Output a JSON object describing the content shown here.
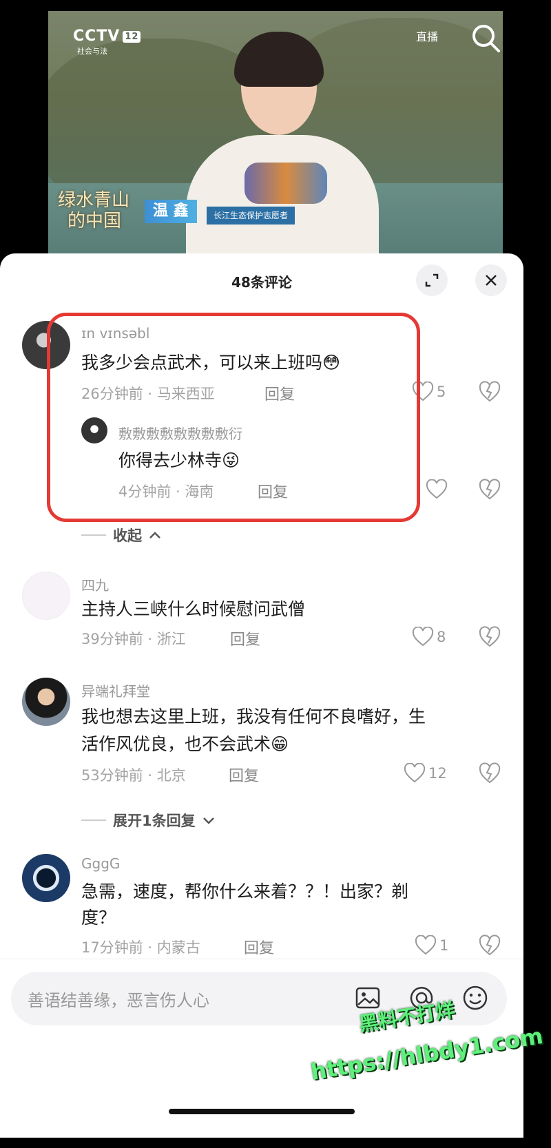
{
  "video": {
    "channel_logo": "CCTV",
    "channel_number": "12",
    "channel_sub": "社会与法",
    "live_label": "直播",
    "show_logo_line1": "绿水青山",
    "show_logo_line2": "的中国",
    "name_tag": "温 鑫",
    "role_tag": "长江生态保护志愿者"
  },
  "sheet": {
    "title": "48条评论"
  },
  "comments": [
    {
      "user": "ɪn vɪnsəbl",
      "text": "我多少会点武术，可以来上班吗😳",
      "meta": "26分钟前 · 马来西亚",
      "reply_label": "回复",
      "likes": "5"
    },
    {
      "user": "敷敷敷敷敷敷敷敷衍",
      "text": "你得去少林寺😜",
      "meta": "4分钟前 · 海南",
      "reply_label": "回复",
      "likes": ""
    },
    {
      "user": "四九",
      "text": "主持人三峡什么时候慰问武僧",
      "meta": "39分钟前 · 浙江",
      "reply_label": "回复",
      "likes": "8"
    },
    {
      "user": "异端礼拜堂",
      "text_line1": "我也想去这里上班，我没有任何不良嗜好，生",
      "text_line2": "活作风优良，也不会武术😁",
      "meta": "53分钟前 · 北京",
      "reply_label": "回复",
      "likes": "12"
    },
    {
      "user": "GggG",
      "text_line1": "急需，速度，帮你什么来着？？！出家？剃",
      "text_line2": "度？",
      "meta": "17分钟前 · 内蒙古",
      "reply_label": "回复",
      "likes": "1"
    }
  ],
  "toggles": {
    "collapse": "收起",
    "expand": "展开1条回复"
  },
  "input": {
    "placeholder": "善语结善缘，恶言伤人心"
  },
  "watermark": {
    "line1": "黑料不打烊",
    "line2": "https://hlbdy1.com"
  },
  "icons": [
    "search-icon",
    "expand-icon",
    "close-icon",
    "heart-icon",
    "broken-heart-icon",
    "image-icon",
    "at-icon",
    "emoji-icon",
    "chevron-up-icon",
    "chevron-down-icon"
  ]
}
